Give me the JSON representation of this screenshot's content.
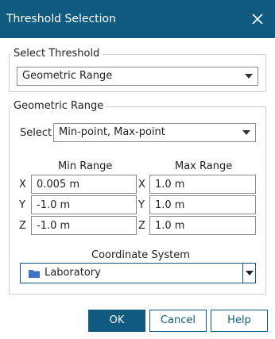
{
  "dialog": {
    "title": "Threshold Selection",
    "close_icon": "close-icon"
  },
  "select_threshold": {
    "group_label": "Select Threshold",
    "selected": "Geometric Range"
  },
  "geometric_range": {
    "group_label": "Geometric Range",
    "select_label": "Select",
    "select_value": "Min-point, Max-point",
    "min_header": "Min Range",
    "max_header": "Max Range",
    "rows": [
      {
        "axis": "X",
        "min": "0.005 m",
        "max": "1.0 m"
      },
      {
        "axis": "Y",
        "min": "-1.0 m",
        "max": "1.0 m"
      },
      {
        "axis": "Z",
        "min": "-1.0 m",
        "max": "1.0 m"
      }
    ],
    "coordinate_system_label": "Coordinate System",
    "coordinate_system_value": "Laboratory",
    "coordinate_system_icon": "folder-icon"
  },
  "buttons": {
    "ok": "OK",
    "cancel": "Cancel",
    "help": "Help"
  },
  "colors": {
    "accent": "#0f5a7e",
    "folder": "#3f73c9"
  }
}
